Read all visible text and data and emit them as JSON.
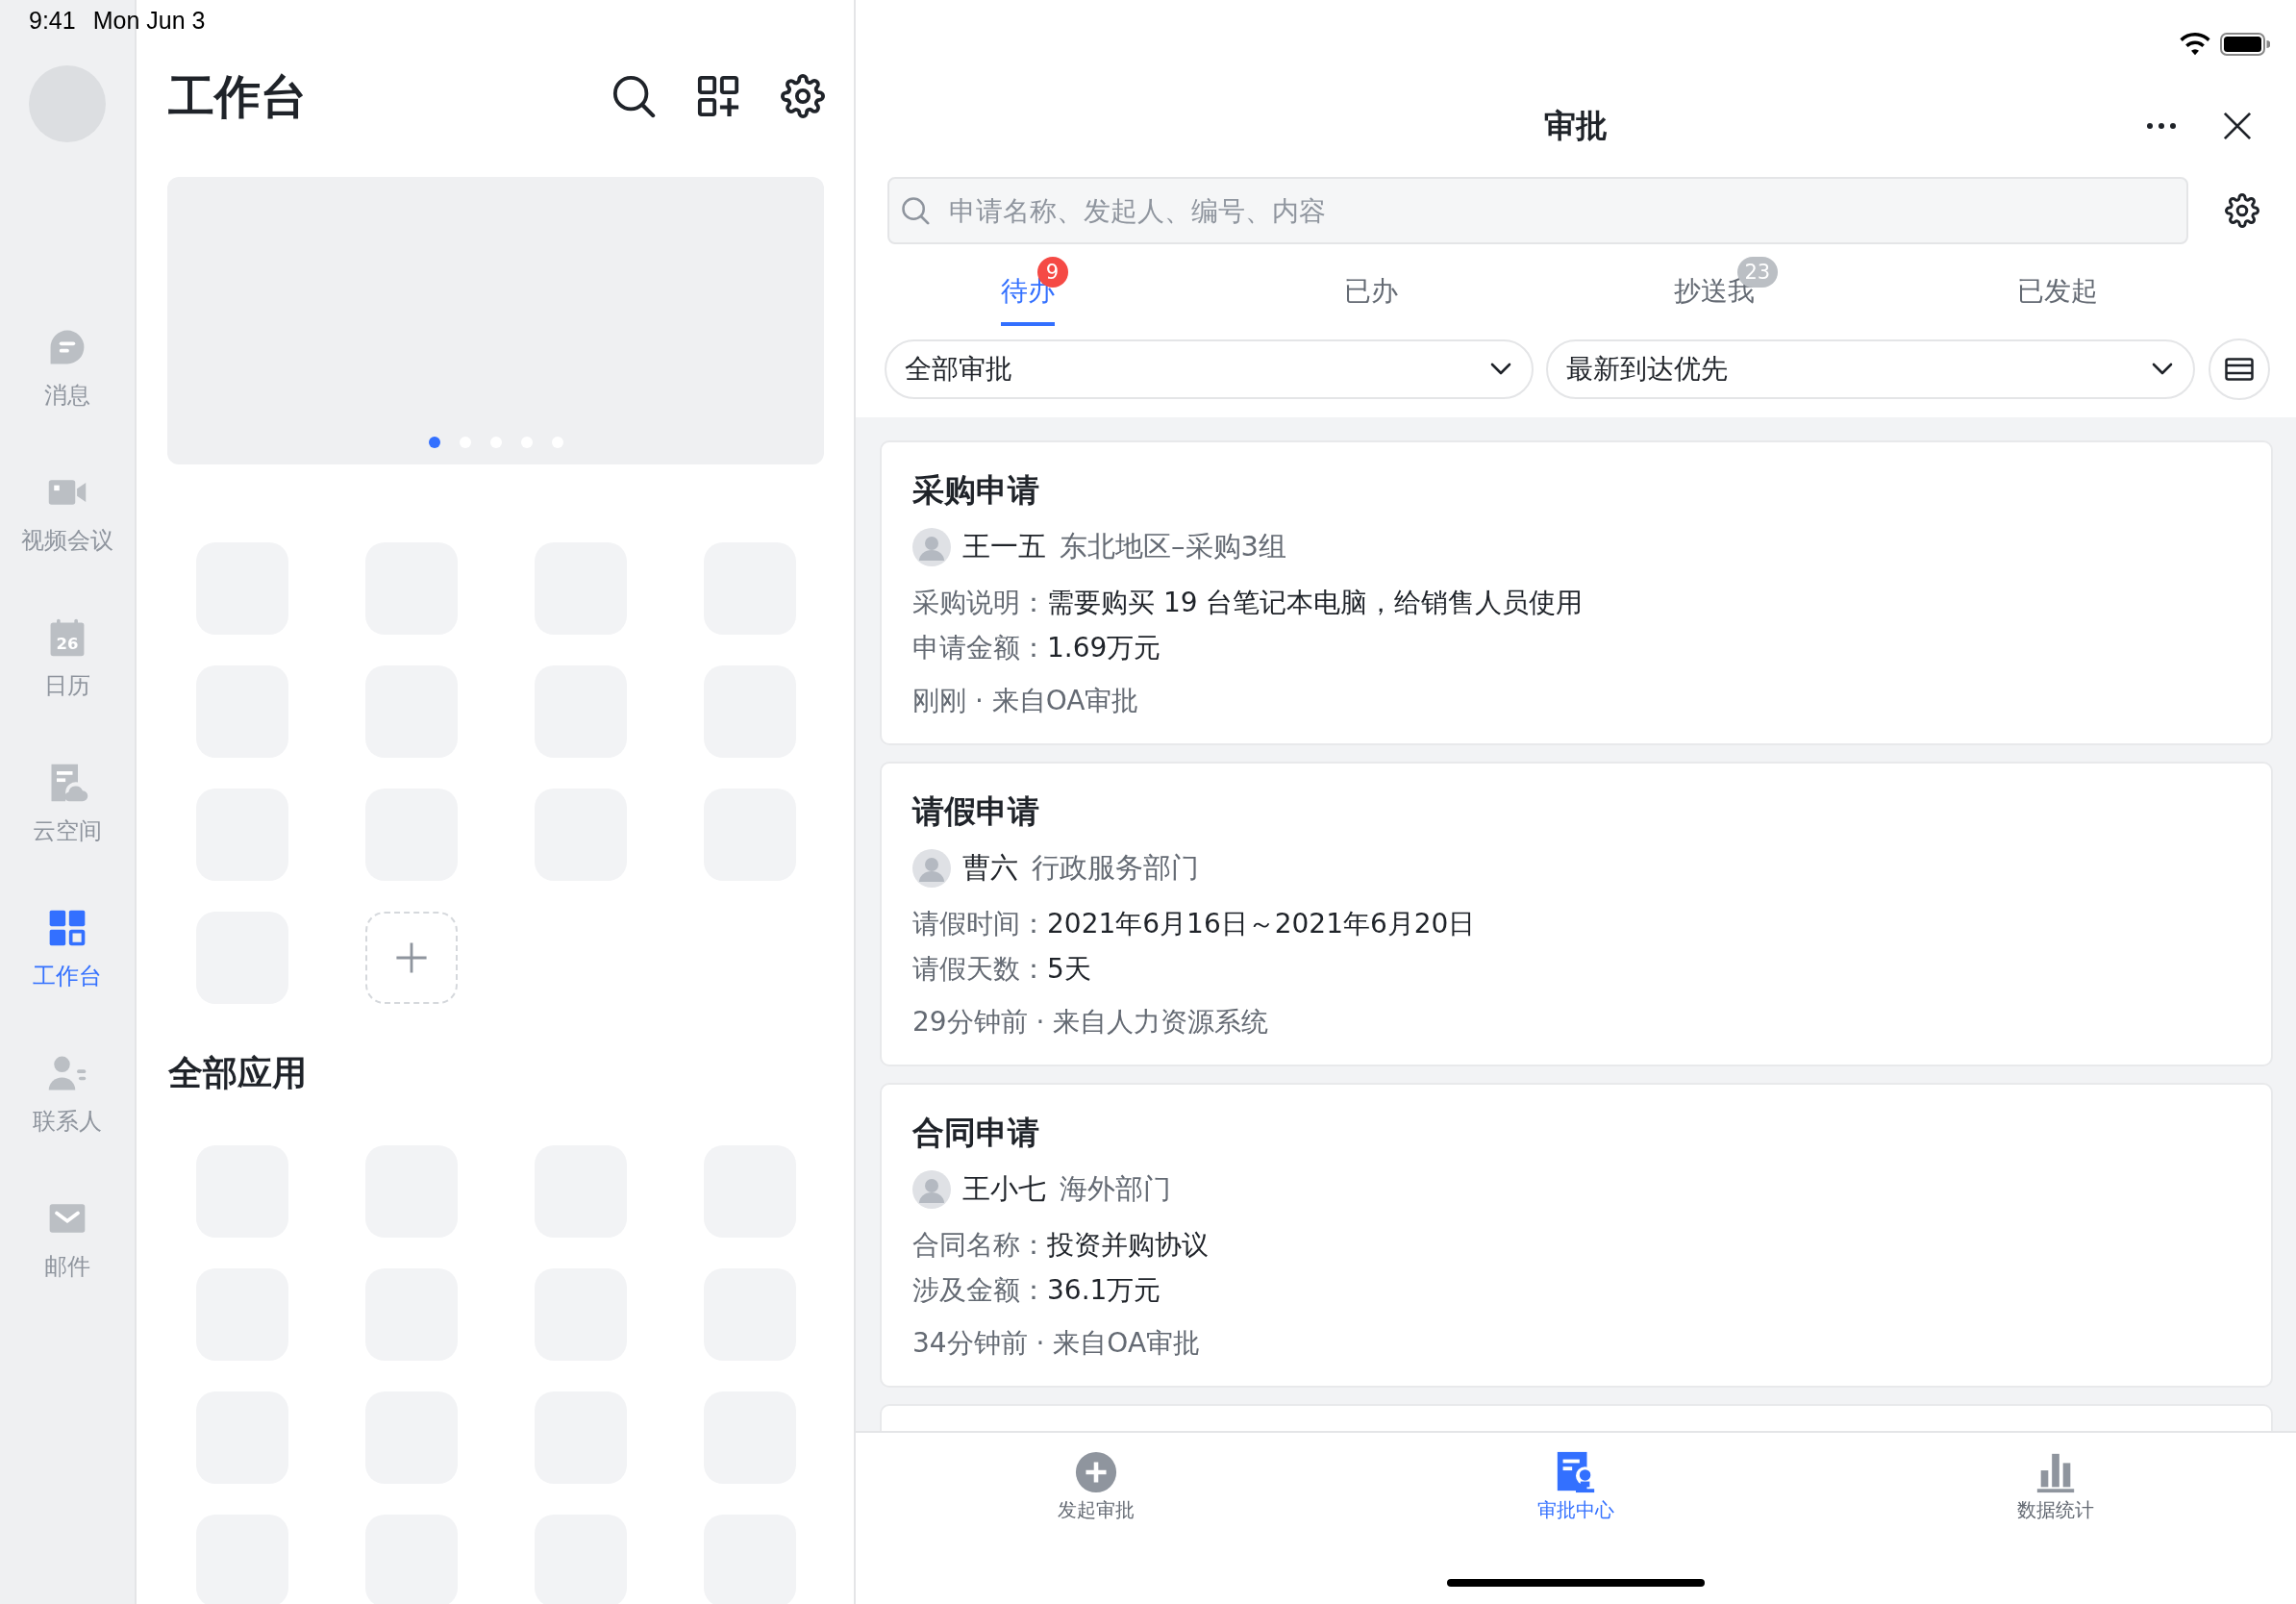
{
  "status_bar": {
    "time": "9:41",
    "date": "Mon Jun 3"
  },
  "sidebar": {
    "items": [
      {
        "label": "消息",
        "selected": false
      },
      {
        "label": "视频会议",
        "selected": false
      },
      {
        "label": "日历",
        "selected": false,
        "icon_text": "26"
      },
      {
        "label": "云空间",
        "selected": false
      },
      {
        "label": "工作台",
        "selected": true
      },
      {
        "label": "联系人",
        "selected": false
      },
      {
        "label": "邮件",
        "selected": false
      }
    ]
  },
  "workbench": {
    "title": "工作台",
    "banner": {
      "pages": [
        {
          "selected": true
        },
        {
          "selected": false
        },
        {
          "selected": false
        },
        {
          "selected": false
        },
        {
          "selected": false
        }
      ]
    },
    "pinned_apps": [
      {
        "kind": "app"
      },
      {
        "kind": "app"
      },
      {
        "kind": "app"
      },
      {
        "kind": "app"
      },
      {
        "kind": "app"
      },
      {
        "kind": "app"
      },
      {
        "kind": "app"
      },
      {
        "kind": "app"
      },
      {
        "kind": "app"
      },
      {
        "kind": "app"
      },
      {
        "kind": "app"
      },
      {
        "kind": "app"
      },
      {
        "kind": "app"
      },
      {
        "kind": "add"
      }
    ],
    "all_apps": {
      "title": "全部应用",
      "apps": [
        {
          "kind": "app"
        },
        {
          "kind": "app"
        },
        {
          "kind": "app"
        },
        {
          "kind": "app"
        },
        {
          "kind": "app"
        },
        {
          "kind": "app"
        },
        {
          "kind": "app"
        },
        {
          "kind": "app"
        },
        {
          "kind": "app"
        },
        {
          "kind": "app"
        },
        {
          "kind": "app"
        },
        {
          "kind": "app"
        },
        {
          "kind": "app"
        },
        {
          "kind": "app"
        },
        {
          "kind": "app"
        },
        {
          "kind": "app"
        }
      ]
    }
  },
  "approval": {
    "title": "审批",
    "search": {
      "placeholder": "申请名称、发起人、编号、内容"
    },
    "tabs": [
      {
        "label": "待办",
        "selected": true,
        "badge": {
          "text": "9",
          "color": "#f54a45"
        }
      },
      {
        "label": "已办",
        "selected": false
      },
      {
        "label": "抄送我",
        "selected": false,
        "badge": {
          "text": "23",
          "color": "#bbbfc4"
        }
      },
      {
        "label": "已发起",
        "selected": false
      }
    ],
    "filters": [
      {
        "label": "全部审批"
      },
      {
        "label": "最新到达优先"
      }
    ],
    "cards": [
      {
        "title": "采购申请",
        "applicant": "王一五",
        "department": "东北地区–采购3组",
        "fields": [
          {
            "label": "采购说明：",
            "value": "需要购买 19 台笔记本电脑，给销售人员使用"
          },
          {
            "label": "申请金额：",
            "value": "1.69万元"
          }
        ],
        "meta": "刚刚 · 来自OA审批"
      },
      {
        "title": "请假申请",
        "applicant": "曹六",
        "department": "行政服务部门",
        "fields": [
          {
            "label": "请假时间：",
            "value": "2021年6月16日～2021年6月20日"
          },
          {
            "label": "请假天数：",
            "value": "5天"
          }
        ],
        "meta": "29分钟前 · 来自人力资源系统"
      },
      {
        "title": "合同申请",
        "applicant": "王小七",
        "department": "海外部门",
        "fields": [
          {
            "label": "合同名称：",
            "value": "投资并购协议"
          },
          {
            "label": "涉及金额：",
            "value": "36.1万元"
          }
        ],
        "meta": "34分钟前 · 来自OA审批"
      }
    ],
    "bottom_nav": [
      {
        "label": "发起审批",
        "selected": false
      },
      {
        "label": "审批中心",
        "selected": true
      },
      {
        "label": "数据统计",
        "selected": false
      }
    ]
  }
}
